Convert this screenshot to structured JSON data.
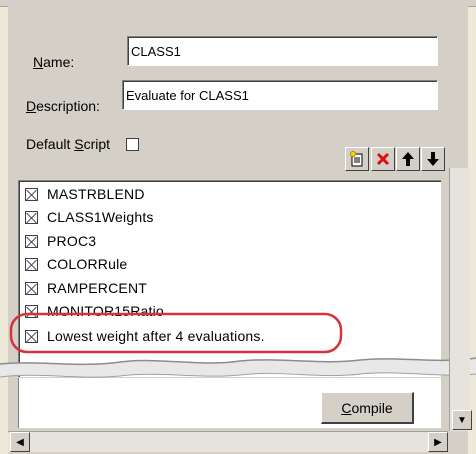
{
  "form": {
    "name_label_pre": "",
    "name_label_u": "N",
    "name_label_post": "ame:",
    "name_value": "CLASS1",
    "desc_label_u": "D",
    "desc_label_post": "escription:",
    "desc_value": "Evaluate for CLASS1",
    "default_script_label_pre": "Default ",
    "default_script_label_u": "S",
    "default_script_label_post": "cript"
  },
  "toolbar": {
    "new_icon": "new-document-icon",
    "delete_icon": "delete-x-icon",
    "up_icon": "arrow-up-icon",
    "down_icon": "arrow-down-icon"
  },
  "list": {
    "items": [
      {
        "label": "MASTRBLEND"
      },
      {
        "label": "CLASS1Weights"
      },
      {
        "label": "PROC3"
      },
      {
        "label": "COLORRule"
      },
      {
        "label": "RAMPERCENT"
      },
      {
        "label": "MONITOR15Ratio"
      },
      {
        "label": "Lowest weight after 4 evaluations."
      }
    ]
  },
  "buttons": {
    "compile_u": "C",
    "compile_post": "ompile"
  },
  "colors": {
    "highlight": "#d9323a",
    "dialog_bg": "#d4d0c8"
  }
}
